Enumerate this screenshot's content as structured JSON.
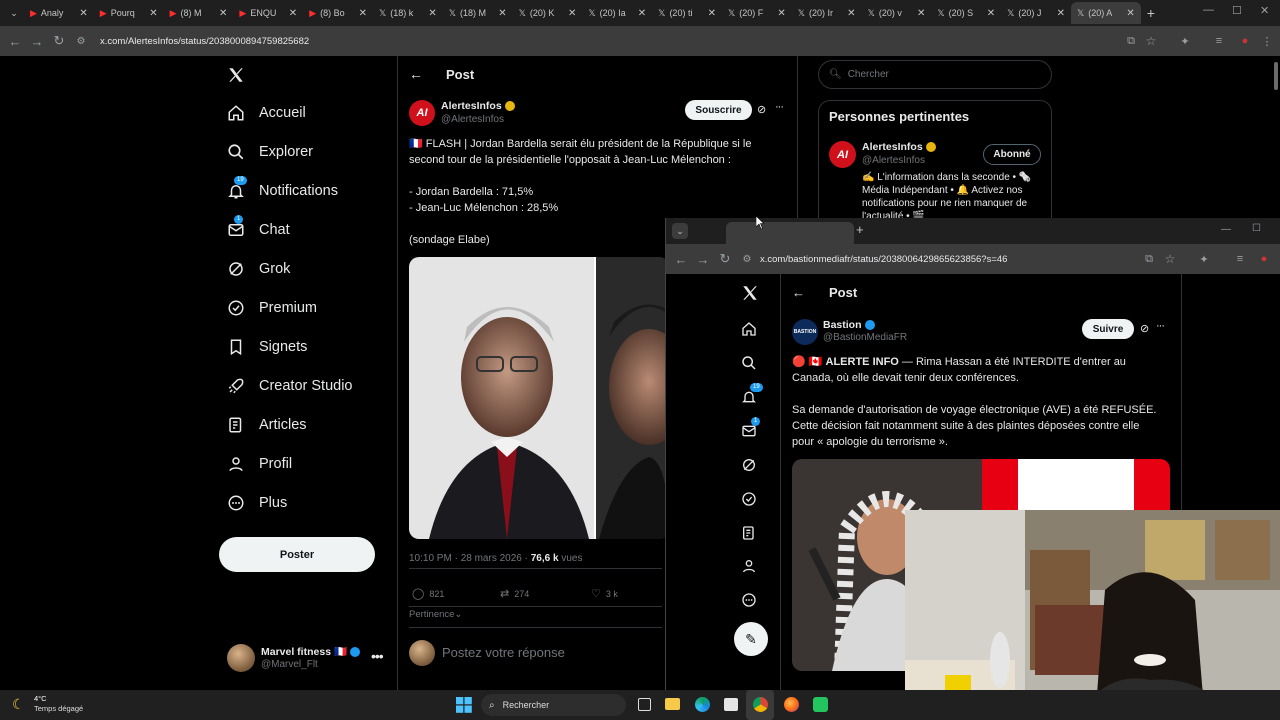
{
  "browser": {
    "tabs": [
      {
        "label": "Analy",
        "icon": "youtube-icon"
      },
      {
        "label": "Pourq",
        "icon": "youtube-icon"
      },
      {
        "label": "(8) M",
        "icon": "youtube-icon"
      },
      {
        "label": "ENQU",
        "icon": "youtube-icon"
      },
      {
        "label": "(8) Bo",
        "icon": "youtube-icon"
      },
      {
        "label": "(18) k",
        "icon": "x-icon"
      },
      {
        "label": "(18) M",
        "icon": "x-icon"
      },
      {
        "label": "(20) K",
        "icon": "x-icon"
      },
      {
        "label": "(20) Ia",
        "icon": "x-icon"
      },
      {
        "label": "(20) ti",
        "icon": "x-icon"
      },
      {
        "label": "(20) F",
        "icon": "x-icon"
      },
      {
        "label": "(20) Ir",
        "icon": "x-icon"
      },
      {
        "label": "(20) v",
        "icon": "x-icon"
      },
      {
        "label": "(20) S",
        "icon": "x-icon"
      },
      {
        "label": "(20) J",
        "icon": "x-icon"
      },
      {
        "label": "(20) A",
        "icon": "x-icon",
        "active": true
      }
    ],
    "url": "x.com/AlertesInfos/status/2038000894759825682"
  },
  "sidebar": {
    "items": [
      {
        "label": "Accueil",
        "icon": "home-icon"
      },
      {
        "label": "Explorer",
        "icon": "search-icon"
      },
      {
        "label": "Notifications",
        "icon": "bell-icon",
        "badge": "19"
      },
      {
        "label": "Chat",
        "icon": "mail-icon",
        "badge": "1"
      },
      {
        "label": "Grok",
        "icon": "grok-icon"
      },
      {
        "label": "Premium",
        "icon": "premium-icon"
      },
      {
        "label": "Signets",
        "icon": "bookmark-icon"
      },
      {
        "label": "Creator Studio",
        "icon": "rocket-icon"
      },
      {
        "label": "Articles",
        "icon": "articles-icon"
      },
      {
        "label": "Profil",
        "icon": "profile-icon"
      },
      {
        "label": "Plus",
        "icon": "more-circle-icon"
      }
    ],
    "post_label": "Poster",
    "account": {
      "name": "Marvel fitness 🇫🇷",
      "handle": "@Marvel_Flt"
    }
  },
  "main": {
    "header": "Post",
    "author": {
      "name": "AlertesInfos",
      "handle": "@AlertesInfos"
    },
    "subscribe_label": "Souscrire",
    "text": {
      "line1": "🇫🇷 FLASH | Jordan Bardella serait élu président de la République si le",
      "line2": "second tour de la présidentielle l'opposait à Jean-Luc Mélenchon :",
      "line3": "- Jordan Bardella : 71,5%",
      "line4": "- Jean-Luc Mélenchon : 28,5%",
      "line5": "(sondage Elabe)"
    },
    "meta": {
      "time": "10:10 PM · 28 mars 2026 · ",
      "views": "76,6 k",
      "views_label": " vues"
    },
    "stats": {
      "replies": "821",
      "reposts": "274",
      "likes": "3 k"
    },
    "sort_label": "Pertinence",
    "reply_placeholder": "Postez votre réponse"
  },
  "right": {
    "search_placeholder": "Chercher",
    "relevant_title": "Personnes pertinentes",
    "person": {
      "name": "AlertesInfos",
      "handle": "@AlertesInfos",
      "follow_label": "Abonné",
      "bio1": "✍️ L'information dans la seconde • 🗞️",
      "bio2": "Média Indépendant • 🔔 Activez nos",
      "bio3": "notifications pour ne rien manquer de",
      "bio4": "l'actualité • 🎬"
    }
  },
  "window2": {
    "url": "x.com/bastionmediafr/status/2038006429865623856?s=46",
    "header": "Post",
    "author": {
      "name": "Bastion",
      "handle": "@BastionMediaFR"
    },
    "follow_label": "Suivre",
    "badges": {
      "notifications": "19",
      "chat": "1"
    },
    "text": {
      "line1a": "🔴 🇨🇦 ",
      "line1b": "ALERTE INFO",
      "line1c": " — Rima Hassan a été INTERDITE d'entrer au",
      "line2": "Canada, où elle devait tenir deux conférences.",
      "line3": "Sa demande d'autorisation de voyage électronique (AVE) a été REFUSÉE.",
      "line4": "Cette décision fait notamment suite à des plaintes déposées contre elle",
      "line5": "pour « apologie du terrorisme »."
    }
  },
  "taskbar": {
    "weather_temp": "4°C",
    "weather_desc": "Temps dégagé",
    "search_label": "Rechercher"
  },
  "colors": {
    "background": "#000000",
    "accent_blue": "#1d9bf0",
    "brand_red": "#d0101b",
    "verified_gold": "#e8b40f",
    "tab_strip": "#1f1f1f",
    "address_bar": "#3c3c3c"
  }
}
